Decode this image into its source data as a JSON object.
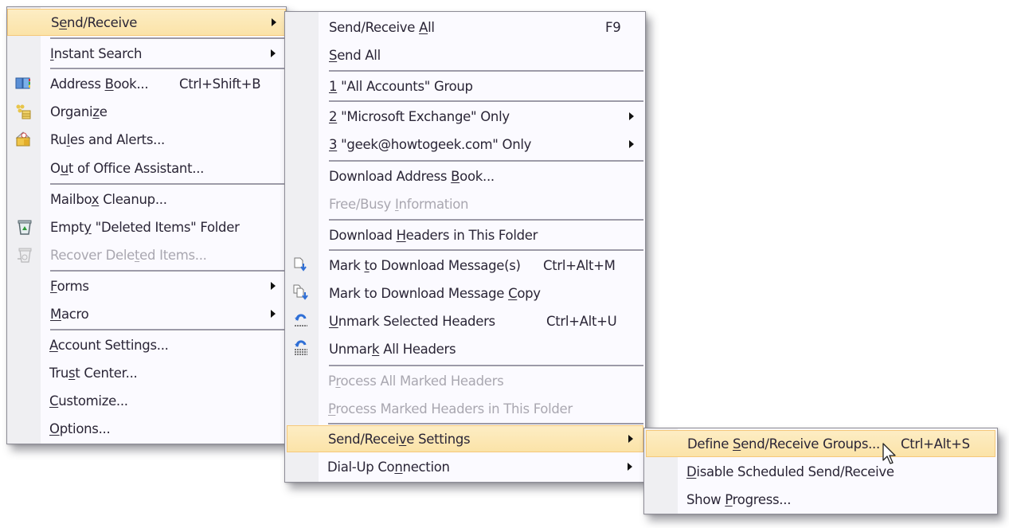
{
  "menu_tools": {
    "items": [
      {
        "label": "Send/Receive",
        "mnemonic": "e",
        "submenu": true,
        "highlighted": true
      },
      {
        "label": "Instant Search",
        "mnemonic": "I",
        "submenu": true
      },
      {
        "label": "Address Book...",
        "mnemonic": "B",
        "shortcut": "Ctrl+Shift+B",
        "icon": "address-book-icon"
      },
      {
        "label": "Organize",
        "mnemonic": "z",
        "icon": "organize-icon"
      },
      {
        "label": "Rules and Alerts...",
        "mnemonic": "l",
        "icon": "rules-alerts-icon"
      },
      {
        "label": "Out of Office Assistant...",
        "mnemonic": "u"
      },
      {
        "label": "Mailbox Cleanup...",
        "mnemonic": "x"
      },
      {
        "label": "Empty \"Deleted Items\" Folder",
        "mnemonic": "y",
        "icon": "empty-trash-icon"
      },
      {
        "label": "Recover Deleted Items...",
        "mnemonic": "t",
        "disabled": true,
        "icon": "recover-items-icon"
      },
      {
        "label": "Forms",
        "mnemonic": "F",
        "submenu": true
      },
      {
        "label": "Macro",
        "mnemonic": "M",
        "submenu": true
      },
      {
        "label": "Account Settings...",
        "mnemonic": "A"
      },
      {
        "label": "Trust Center...",
        "mnemonic": "s"
      },
      {
        "label": "Customize...",
        "mnemonic": "C"
      },
      {
        "label": "Options...",
        "mnemonic": "O"
      }
    ]
  },
  "menu_send_receive": {
    "items": [
      {
        "label": "Send/Receive All",
        "mnemonic": "A",
        "shortcut": "F9"
      },
      {
        "label": "Send All",
        "mnemonic": "S"
      },
      {
        "label": "1 \"All Accounts\" Group",
        "mnemonic": "1"
      },
      {
        "label": "2 \"Microsoft Exchange\" Only",
        "mnemonic": "2",
        "submenu": true
      },
      {
        "label": "3 \"geek@howtogeek.com\" Only",
        "mnemonic": "3",
        "submenu": true
      },
      {
        "label": "Download Address Book...",
        "mnemonic": "B"
      },
      {
        "label": "Free/Busy Information",
        "mnemonic": "I",
        "disabled": true
      },
      {
        "label": "Download Headers in This Folder",
        "mnemonic": "H"
      },
      {
        "label": "Mark to Download Message(s)",
        "mnemonic": "t",
        "shortcut": "Ctrl+Alt+M",
        "icon": "mark-download-icon"
      },
      {
        "label": "Mark to Download Message Copy",
        "mnemonic": "C",
        "icon": "mark-download-copy-icon"
      },
      {
        "label": "Unmark Selected Headers",
        "mnemonic": "U",
        "shortcut": "Ctrl+Alt+U",
        "icon": "unmark-selected-icon"
      },
      {
        "label": "Unmark All Headers",
        "mnemonic": "k",
        "icon": "unmark-all-icon"
      },
      {
        "label": "Process All Marked Headers",
        "mnemonic": "r",
        "disabled": true
      },
      {
        "label": "Process Marked Headers in This Folder",
        "mnemonic": "P",
        "disabled": true
      },
      {
        "label": "Send/Receive Settings",
        "mnemonic": "v",
        "submenu": true,
        "highlighted": true
      },
      {
        "label": "Dial-Up Connection",
        "mnemonic": "n",
        "submenu": true
      }
    ]
  },
  "menu_settings": {
    "items": [
      {
        "label": "Define Send/Receive Groups...",
        "mnemonic": "S",
        "shortcut": "Ctrl+Alt+S",
        "highlighted": true
      },
      {
        "label": "Disable Scheduled Send/Receive",
        "mnemonic": "D"
      },
      {
        "label": "Show Progress...",
        "mnemonic": "P"
      }
    ]
  },
  "colors": {
    "highlight_bg": "#fbe3a8",
    "highlight_border": "#f5c87a",
    "menu_bg": "#fbfaff",
    "gutter_bg": "#efeff2",
    "disabled_text": "#a9a7b0"
  }
}
